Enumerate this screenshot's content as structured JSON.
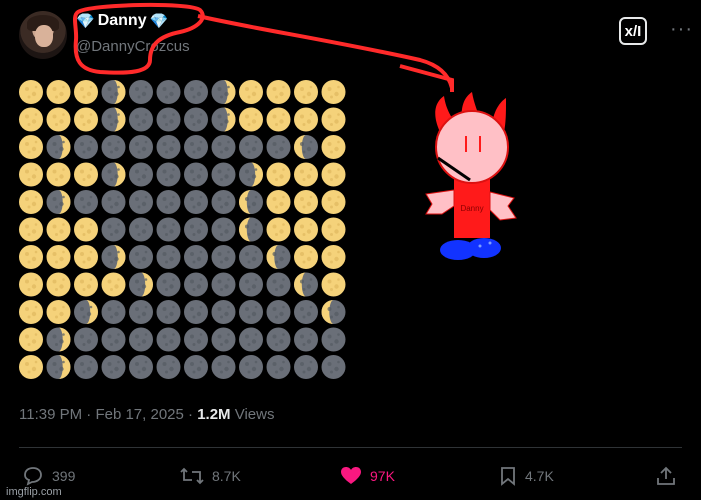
{
  "author": {
    "display_name": "Danny",
    "badge_icon": "gem-icon",
    "handle": "@DannyCrozcus"
  },
  "header": {
    "grok_label": "x/I",
    "more_icon": "more-icon"
  },
  "post_meta": {
    "time": "11:39 PM",
    "date": "Feb 17, 2025",
    "views_count": "1.2M",
    "views_label": "Views"
  },
  "actions": {
    "replies": "399",
    "reposts": "8.7K",
    "likes": "97K",
    "bookmarks": "4.7K"
  },
  "drawing": {
    "shirt_label": "Danny"
  },
  "watermark": "imgflip.com",
  "colors": {
    "moon_lit": "#f5d27a",
    "moon_dark": "#6a6f78",
    "annotation_red": "#ff2a2a",
    "character_red": "#ff1a1a",
    "like_pink": "#f91880"
  }
}
